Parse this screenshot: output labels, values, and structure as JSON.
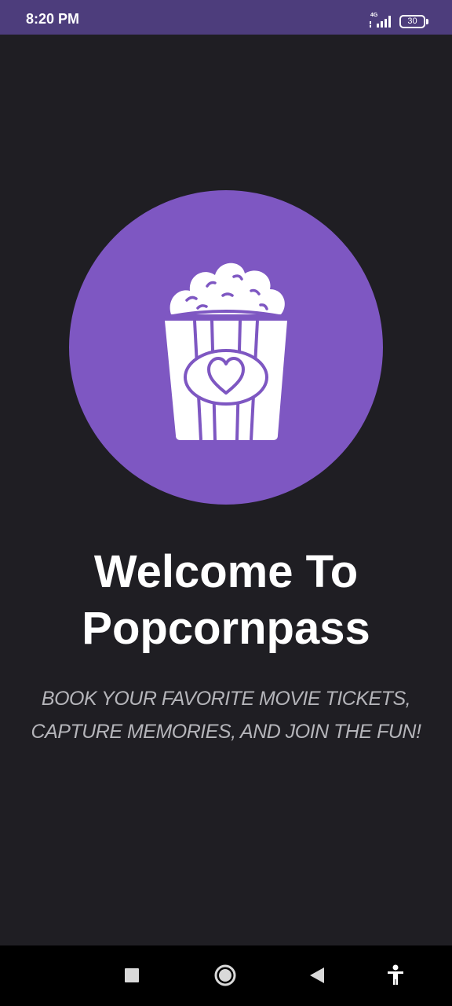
{
  "status_bar": {
    "time": "8:20 PM",
    "network_label": "4G",
    "battery_level": "30",
    "icons": [
      "signal-icon",
      "battery-icon"
    ]
  },
  "welcome": {
    "logo_icon": "popcorn-heart-icon",
    "title_line1": "Welcome To",
    "title_line2": "Popcornpass",
    "subtitle_line1": "BOOK YOUR FAVORITE MOVIE TICKETS,",
    "subtitle_line2": "CAPTURE MEMORIES, AND JOIN THE FUN!"
  },
  "navigation_bar": {
    "buttons": [
      "recents-icon",
      "home-icon",
      "back-icon",
      "accessibility-icon"
    ]
  },
  "colors": {
    "status_bar": "#4d3d7c",
    "background": "#1f1e23",
    "accent": "#7e57c2",
    "title_text": "#ffffff",
    "subtitle_text": "#b5b5ba",
    "nav_bar": "#000000"
  }
}
